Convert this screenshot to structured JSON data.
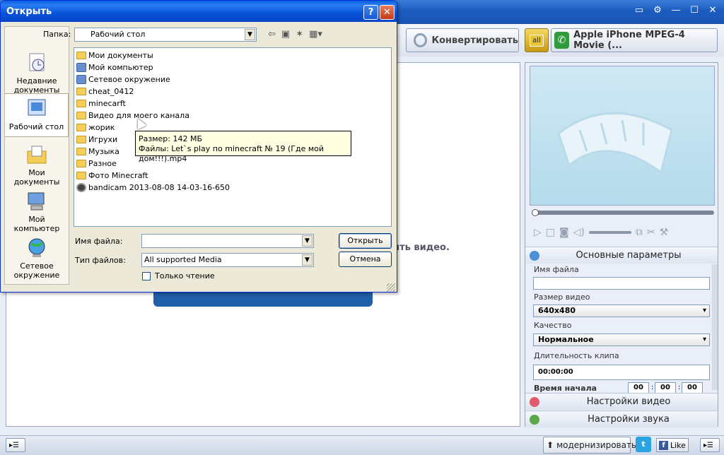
{
  "app": {
    "convert_label": "Конвертировать",
    "all_label": "all",
    "profile_label": "Apple iPhone MPEG-4 Movie (...",
    "drop_hint": "ить видео.",
    "colors": {
      "title_blue": "#1c5cc0",
      "dialog_blue": "#0653d8",
      "accent_green": "#2f9b3c"
    }
  },
  "right_panel": {
    "basic_params": "Основные параметры",
    "file_name_label": "Имя файла",
    "file_name_value": "",
    "video_size_label": "Размер видео",
    "video_size_value": "640x480",
    "quality_label": "Качество",
    "quality_value": "Нормальное",
    "clip_duration_label": "Длительность клипа",
    "clip_duration_value": "00:00:00",
    "start_time_label": "Время начала",
    "start_time": [
      "00",
      "00",
      "00"
    ],
    "video_settings": "Настройки видео",
    "audio_settings": "Настройки звука"
  },
  "statusbar": {
    "upgrade_label": "модернизировать",
    "like_label": "Like",
    "twitter_glyph": "t",
    "facebook_glyph": "f"
  },
  "dialog": {
    "title": "Открыть",
    "help": "?",
    "close": "✕",
    "look_in_label": "Папка:",
    "look_in_value": "Рабочий стол",
    "places": [
      {
        "label": "Недавние документы"
      },
      {
        "label": "Рабочий стол"
      },
      {
        "label": "Мои документы"
      },
      {
        "label": "Мой компьютер"
      },
      {
        "label": "Сетевое окружение"
      }
    ],
    "files": [
      {
        "name": "Мои документы",
        "icon": "system-folder-icon"
      },
      {
        "name": "Мой компьютер",
        "icon": "computer-icon"
      },
      {
        "name": "Сетевое окружение",
        "icon": "network-icon"
      },
      {
        "name": "cheat_0412",
        "icon": "folder-icon"
      },
      {
        "name": "minecarft",
        "icon": "folder-icon"
      },
      {
        "name": "Видео для моего канала",
        "icon": "folder-icon"
      },
      {
        "name": "жорик",
        "icon": "folder-icon"
      },
      {
        "name": "Игрухи",
        "icon": "folder-icon"
      },
      {
        "name": "Музыка",
        "icon": "folder-icon"
      },
      {
        "name": "Разное",
        "icon": "folder-icon"
      },
      {
        "name": "Фото Minecraft",
        "icon": "folder-icon"
      },
      {
        "name": "bandicam 2013-08-08 14-03-16-650",
        "icon": "video-file-icon"
      }
    ],
    "tooltip_line1": "Размер: 142 МБ",
    "tooltip_line2": "Файлы: Let`s play по minecraft № 19 (Где мой дом!!!).mp4",
    "file_name_label": "Имя файла:",
    "file_name_value": "",
    "file_type_label": "Тип файлов:",
    "file_type_value": "All supported Media",
    "read_only_label": "Только чтение",
    "open_button": "Открыть",
    "cancel_button": "Отмена"
  }
}
